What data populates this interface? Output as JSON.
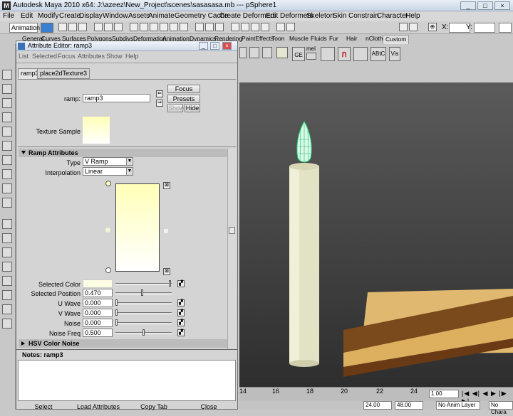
{
  "window": {
    "title": "Autodesk Maya 2010 x64: J:\\azeez\\New_Project\\scenes\\sasasasa.mb    ---    pSphere1"
  },
  "menubar": [
    "File",
    "Edit",
    "Modify",
    "Create",
    "Display",
    "Window",
    "Assets",
    "Animate",
    "Geometry Cache",
    "Create Deformers",
    "Edit Deformers",
    "Skeleton",
    "Skin",
    "Constrain",
    "Character",
    "Help"
  ],
  "statusline": {
    "mode": "Animation",
    "x_label": "X:",
    "y_label": "Y:"
  },
  "shelf_tabs": [
    "General",
    "Curves",
    "Surfaces",
    "Polygons",
    "Subdivs",
    "Deformation",
    "Animation",
    "Dynamics",
    "Rendering",
    "PaintEffects",
    "Toon",
    "Muscle",
    "Fluids",
    "Fur",
    "Hair",
    "nCloth",
    "Custom"
  ],
  "viewport_toolbar": {
    "ge_label": "GE",
    "mel_label": "mel",
    "abtc_label": "ABtC",
    "vis_label": "Vis"
  },
  "attribute_editor": {
    "title": "Attribute Editor: ramp3",
    "menu": [
      "List",
      "Selected",
      "Focus",
      "Attributes",
      "Show",
      "Help"
    ],
    "tabs": [
      "ramp3",
      "place2dTexture3"
    ],
    "node_label": "ramp:",
    "node_name": "ramp3",
    "buttons": {
      "focus": "Focus",
      "presets": "Presets",
      "show": "Show",
      "hide": "Hide"
    },
    "texture_sample_label": "Texture Sample",
    "ramp_attributes": {
      "header": "Ramp Attributes",
      "type_label": "Type",
      "type_value": "V Ramp",
      "interpolation_label": "Interpolation",
      "interpolation_value": "Linear",
      "selected_color_label": "Selected Color",
      "selected_position_label": "Selected Position",
      "selected_position": "0.470",
      "u_wave_label": "U Wave",
      "u_wave": "0.000",
      "v_wave_label": "V Wave",
      "v_wave": "0.000",
      "noise_label": "Noise",
      "noise": "0.000",
      "noise_freq_label": "Noise Freq",
      "noise_freq": "0.500",
      "selected_position_fraction": 0.47,
      "noise_freq_fraction": 0.5
    },
    "hsv_header": "HSV Color Noise",
    "notes_label": "Notes:  ramp3",
    "bottom_buttons": [
      "Select",
      "Load Attributes",
      "Copy Tab",
      "Close"
    ],
    "ramp_top_color": "#ffffb8",
    "ramp_bottom_color": "#ffffff"
  },
  "timeline": {
    "ticks": [
      "14",
      "16",
      "18",
      "20",
      "22",
      "24"
    ],
    "current_frame": "1.00"
  },
  "range": {
    "start": "24.00",
    "end": "48.00",
    "anim_layer": "No Anim Layer",
    "character": "No Chara"
  }
}
